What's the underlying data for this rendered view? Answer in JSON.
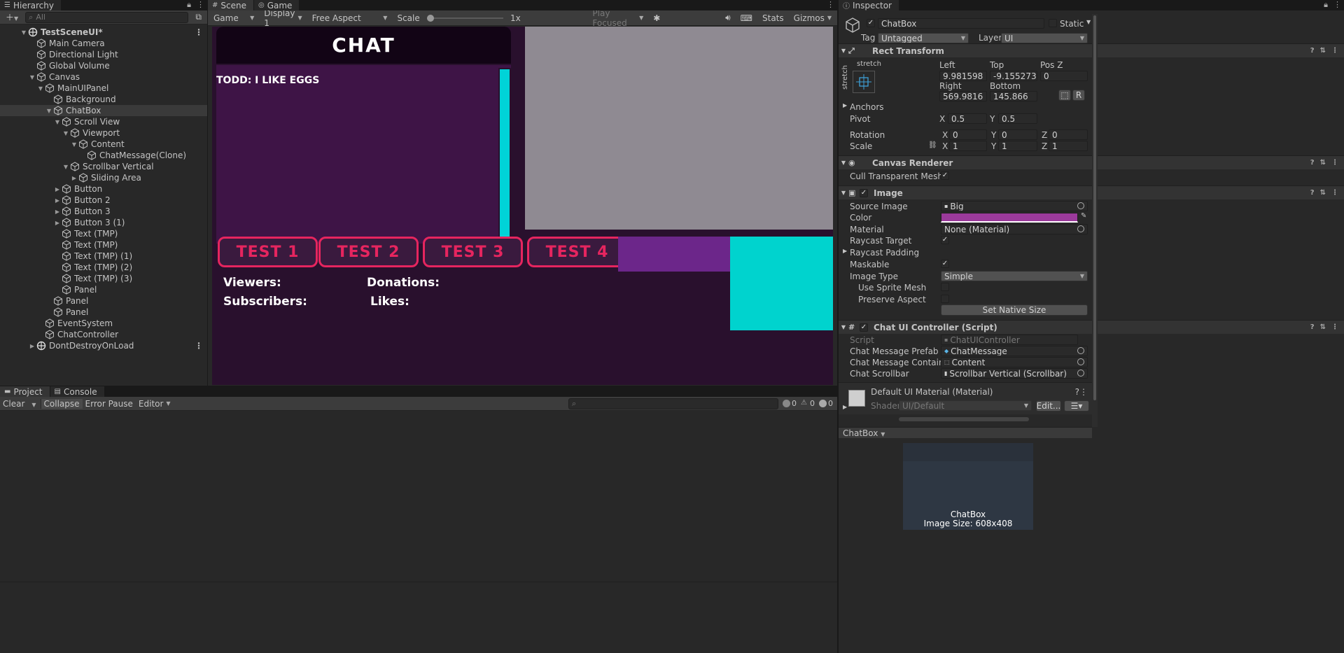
{
  "hierarchy": {
    "tab": "Hierarchy",
    "search_placeholder": "All",
    "rows": [
      {
        "label": "TestSceneUI*",
        "indent": 0,
        "arrow": "▼",
        "icon": "scene",
        "bold": true,
        "kebab": true
      },
      {
        "label": "Main Camera",
        "indent": 1,
        "arrow": "",
        "icon": "cube"
      },
      {
        "label": "Directional Light",
        "indent": 1,
        "arrow": "",
        "icon": "cube"
      },
      {
        "label": "Global Volume",
        "indent": 1,
        "arrow": "",
        "icon": "cube"
      },
      {
        "label": "Canvas",
        "indent": 1,
        "arrow": "▼",
        "icon": "cube"
      },
      {
        "label": "MainUIPanel",
        "indent": 2,
        "arrow": "▼",
        "icon": "cube"
      },
      {
        "label": "Background",
        "indent": 3,
        "arrow": "",
        "icon": "cube"
      },
      {
        "label": "ChatBox",
        "indent": 3,
        "arrow": "▼",
        "icon": "cube",
        "selected": true
      },
      {
        "label": "Scroll View",
        "indent": 4,
        "arrow": "▼",
        "icon": "cube"
      },
      {
        "label": "Viewport",
        "indent": 5,
        "arrow": "▼",
        "icon": "cube"
      },
      {
        "label": "Content",
        "indent": 6,
        "arrow": "▼",
        "icon": "cube"
      },
      {
        "label": "ChatMessage(Clone)",
        "indent": 7,
        "arrow": "",
        "icon": "cube"
      },
      {
        "label": "Scrollbar Vertical",
        "indent": 5,
        "arrow": "▼",
        "icon": "cube"
      },
      {
        "label": "Sliding Area",
        "indent": 6,
        "arrow": "▶",
        "icon": "cube"
      },
      {
        "label": "Button",
        "indent": 4,
        "arrow": "▶",
        "icon": "cube"
      },
      {
        "label": "Button 2",
        "indent": 4,
        "arrow": "▶",
        "icon": "cube"
      },
      {
        "label": "Button 3",
        "indent": 4,
        "arrow": "▶",
        "icon": "cube"
      },
      {
        "label": "Button 3 (1)",
        "indent": 4,
        "arrow": "▶",
        "icon": "cube"
      },
      {
        "label": "Text (TMP)",
        "indent": 4,
        "arrow": "",
        "icon": "cube"
      },
      {
        "label": "Text (TMP)",
        "indent": 4,
        "arrow": "",
        "icon": "cube"
      },
      {
        "label": "Text (TMP) (1)",
        "indent": 4,
        "arrow": "",
        "icon": "cube"
      },
      {
        "label": "Text (TMP) (2)",
        "indent": 4,
        "arrow": "",
        "icon": "cube"
      },
      {
        "label": "Text (TMP) (3)",
        "indent": 4,
        "arrow": "",
        "icon": "cube"
      },
      {
        "label": "Panel",
        "indent": 4,
        "arrow": "",
        "icon": "cube"
      },
      {
        "label": "Panel",
        "indent": 3,
        "arrow": "",
        "icon": "cube"
      },
      {
        "label": "Panel",
        "indent": 3,
        "arrow": "",
        "icon": "cube"
      },
      {
        "label": "EventSystem",
        "indent": 2,
        "arrow": "",
        "icon": "cube"
      },
      {
        "label": "ChatController",
        "indent": 2,
        "arrow": "",
        "icon": "cube"
      },
      {
        "label": "DontDestroyOnLoad",
        "indent": 1,
        "arrow": "▶",
        "icon": "scene",
        "kebab": true
      }
    ]
  },
  "gameview": {
    "tabs": {
      "scene": "Scene",
      "game": "Game"
    },
    "toolbar": {
      "mode": "Game",
      "display": "Display 1",
      "aspect": "Free Aspect",
      "scale_label": "Scale",
      "scale_value": "1x",
      "play_focused": "Play Focused",
      "stats": "Stats",
      "gizmos": "Gizmos"
    },
    "game": {
      "chat_title": "CHAT",
      "chat_message": "TODD: I LIKE EGGS",
      "buttons": [
        "TEST 1",
        "TEST 2",
        "TEST 3",
        "TEST 4"
      ],
      "viewers": "Viewers:",
      "donations": "Donations:",
      "subscribers": "Subscribers:",
      "likes": "Likes:"
    }
  },
  "console": {
    "tabs": {
      "project": "Project",
      "console": "Console"
    },
    "clear": "Clear",
    "collapse": "Collapse",
    "error_pause": "Error Pause",
    "editor": "Editor",
    "counts": {
      "log": "0",
      "warn": "0",
      "error": "0"
    }
  },
  "inspector": {
    "tab": "Inspector",
    "object_name": "ChatBox",
    "static_label": "Static",
    "tag_label": "Tag",
    "tag_value": "Untagged",
    "layer_label": "Layer",
    "layer_value": "UI",
    "rect_transform": {
      "title": "Rect Transform",
      "anchor_h": "stretch",
      "anchor_v": "stretch",
      "left_label": "Left",
      "left": "9.981598",
      "top_label": "Top",
      "top": "-9.155273e-0",
      "posz_label": "Pos Z",
      "posz": "0",
      "right_label": "Right",
      "right": "569.9816",
      "bottom_label": "Bottom",
      "bottom": "145.866",
      "anchors_label": "Anchors",
      "pivot_label": "Pivot",
      "pivot_x": "0.5",
      "pivot_y": "0.5",
      "rotation_label": "Rotation",
      "rot_x": "0",
      "rot_y": "0",
      "rot_z": "0",
      "scale_label": "Scale",
      "scale_x": "1",
      "scale_y": "1",
      "scale_z": "1",
      "r_button": "R"
    },
    "canvas_renderer": {
      "title": "Canvas Renderer",
      "cull_label": "Cull Transparent Mesh"
    },
    "image": {
      "title": "Image",
      "source_label": "Source Image",
      "source": "Big",
      "color_label": "Color",
      "color": "#9b3a9b",
      "material_label": "Material",
      "material": "None (Material)",
      "raycast_target_label": "Raycast Target",
      "raycast_padding_label": "Raycast Padding",
      "maskable_label": "Maskable",
      "image_type_label": "Image Type",
      "image_type": "Simple",
      "use_sprite_mesh_label": "Use Sprite Mesh",
      "preserve_aspect_label": "Preserve Aspect",
      "set_native": "Set Native Size"
    },
    "chat_controller": {
      "title": "Chat UI Controller (Script)",
      "script_label": "Script",
      "script": "ChatUIController",
      "prefab_label": "Chat Message Prefab",
      "prefab": "ChatMessage",
      "container_label": "Chat Message Container",
      "container": "Content",
      "scrollbar_label": "Chat Scrollbar",
      "scrollbar": "Scrollbar Vertical (Scrollbar)"
    },
    "material": {
      "title": "Default UI Material (Material)",
      "shader_label": "Shader",
      "shader": "UI/Default",
      "edit": "Edit..."
    },
    "preview": {
      "dropdown": "ChatBox",
      "name": "ChatBox",
      "size": "Image Size: 608x408"
    }
  }
}
